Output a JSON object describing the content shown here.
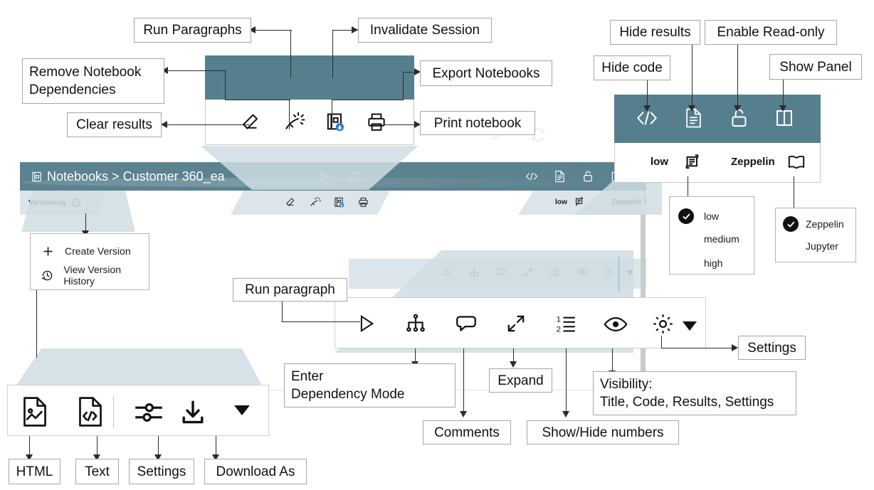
{
  "app": {
    "breadcrumb_icon": "notebook-icon",
    "breadcrumb": "Notebooks > Customer 360_ea",
    "versioning_label": "Versioning",
    "interpreter_level": "low",
    "editor_mode": "Zeppelin"
  },
  "callouts": {
    "run_paragraphs": "Run Paragraphs",
    "invalidate_session": "Invalidate Session",
    "remove_notebook_dependencies": "Remove Notebook\nDependencies",
    "export_notebooks": "Export Notebooks",
    "clear_results": "Clear results",
    "print_notebook": "Print notebook",
    "hide_code": "Hide code",
    "hide_results": "Hide results",
    "enable_read_only": "Enable Read-only",
    "show_panel": "Show Panel",
    "run_paragraph": "Run paragraph",
    "enter_dependency_mode": "Enter\nDependency Mode",
    "comments": "Comments",
    "expand": "Expand",
    "show_hide_numbers": "Show/Hide numbers",
    "visibility": "Visibility:\nTitle, Code, Results, Settings",
    "settings": "Settings",
    "html": "HTML",
    "text": "Text",
    "settings_bottom": "Settings",
    "download_as": "Download As"
  },
  "versioning_menu": {
    "items": [
      {
        "icon": "plus-icon",
        "label": "Create Version"
      },
      {
        "icon": "history-clock-icon",
        "label": "View Version History"
      }
    ]
  },
  "interpreter_menu": {
    "items": [
      {
        "label": "low",
        "selected": true
      },
      {
        "label": "medium",
        "selected": false
      },
      {
        "label": "high",
        "selected": false
      }
    ]
  },
  "editor_menu": {
    "items": [
      {
        "label": "Zeppelin",
        "selected": true
      },
      {
        "label": "Jupyter",
        "selected": false
      }
    ]
  },
  "toolbars": {
    "notebook_primary": [
      {
        "name": "run-paragraphs-icon",
        "title": "Run Paragraphs"
      },
      {
        "name": "invalidate-session-icon",
        "title": "Invalidate Session"
      }
    ],
    "notebook_primary_right": [
      {
        "name": "hide-code-icon",
        "title": "Hide code"
      },
      {
        "name": "hide-results-icon",
        "title": "Hide results"
      },
      {
        "name": "enable-read-only-icon",
        "title": "Enable Read-only"
      },
      {
        "name": "show-panel-icon",
        "title": "Show Panel"
      }
    ],
    "notebook_secondary": [
      {
        "name": "clear-results-icon",
        "title": "Clear results"
      },
      {
        "name": "remove-notebook-dependencies-icon",
        "title": "Remove Notebook Dependencies"
      },
      {
        "name": "export-notebooks-icon",
        "title": "Export Notebooks"
      },
      {
        "name": "print-notebook-icon",
        "title": "Print notebook"
      }
    ],
    "paragraph": [
      {
        "name": "run-paragraph-icon",
        "title": "Run paragraph"
      },
      {
        "name": "dependency-mode-icon",
        "title": "Enter Dependency Mode"
      },
      {
        "name": "comments-icon",
        "title": "Comments"
      },
      {
        "name": "expand-icon",
        "title": "Expand"
      },
      {
        "name": "line-numbers-icon",
        "title": "Show/Hide numbers"
      },
      {
        "name": "visibility-eye-icon",
        "title": "Visibility"
      },
      {
        "name": "settings-gear-icon",
        "title": "Settings"
      },
      {
        "name": "chevron-down-icon",
        "title": "More"
      }
    ],
    "export": [
      {
        "name": "html-export-icon",
        "title": "HTML"
      },
      {
        "name": "text-export-icon",
        "title": "Text"
      },
      {
        "name": "settings-sliders-icon",
        "title": "Settings"
      },
      {
        "name": "download-as-icon",
        "title": "Download As"
      },
      {
        "name": "chevron-down-icon",
        "title": "More"
      }
    ]
  },
  "colors": {
    "teal": "#567f8e",
    "header_teal": "#5b828f",
    "light_blue": "#dbe5ea",
    "accent_blue": "#2f7f9e",
    "badge_blue": "#1f7ed0",
    "ink": "#1b1b1b"
  }
}
